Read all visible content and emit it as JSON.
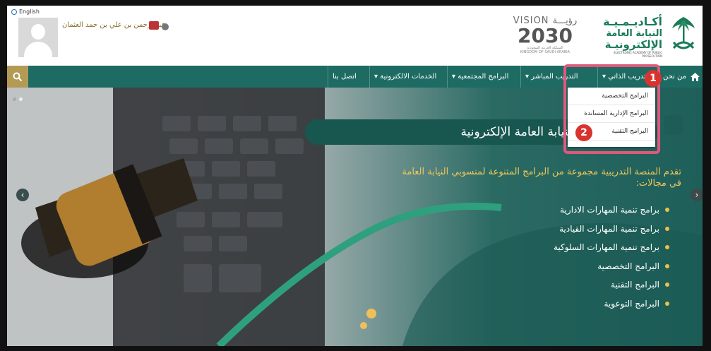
{
  "header": {
    "language_link": "English",
    "user_name": "عبدالرحمن بن علي بن حمد العثمان",
    "vision": {
      "label_en": "VISION",
      "label_ar": "رؤيـــة",
      "year": "2030",
      "country_ar": "المملكة العربية السعودية",
      "country_en": "KINGDOM OF SAUDI ARABIA"
    },
    "academy": {
      "line1": "أكـاديـمـيـة",
      "line2": "النيابة العامة",
      "line3": "الإلكترونيـة",
      "en": "ELECTRONIC ACADEMY OF PUBLIC PROSECUTION"
    }
  },
  "nav": {
    "items": [
      {
        "label": "من نحن"
      },
      {
        "label": "التدريب الذاتي ▾"
      },
      {
        "label": "التدريب المباشر ▾"
      },
      {
        "label": "البرامج المجتمعية ▾"
      },
      {
        "label": "الخدمات الالكترونية ▾"
      },
      {
        "label": "اتصل بنا"
      }
    ],
    "home_icon": "home-icon",
    "search_icon": "search-icon"
  },
  "dropdown": {
    "items": [
      {
        "label": "البرامج التخصصية"
      },
      {
        "label": "البرامج الإدارية المساندة"
      },
      {
        "label": "البرامج التقنية"
      }
    ]
  },
  "annotations": {
    "badge1": "1",
    "badge2": "2",
    "highlight_color": "#e0587a",
    "badge_color": "#d9332f"
  },
  "hero": {
    "title": "منصة أكاديمية النيابة العامة الإلكترونية",
    "intro": "تقدم المنصة التدريبية مجموعة من البرامج المتنوعة لمنسوبي النيابة العامة في مجالات:",
    "list": [
      "برامج تنمية المهارات الادارية",
      "برامج تنمية المهارات القيادية",
      "برامج تنمية المهارات السلوكية",
      "البرامج التخصصية",
      "البرامج التقنية",
      "البرامج التوعوية"
    ],
    "arrow_left": "‹",
    "arrow_right": "›"
  },
  "colors": {
    "primary": "#1d6b63",
    "gold": "#b39a55",
    "accent_text": "#f1c75a"
  }
}
